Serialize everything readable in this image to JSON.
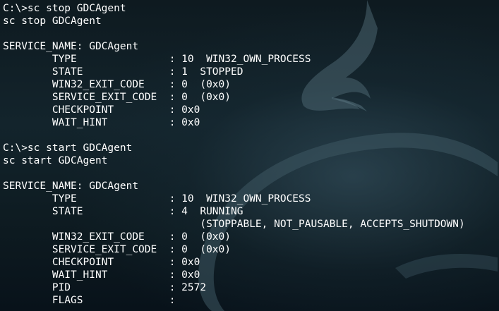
{
  "terminal": {
    "lines": [
      "C:\\>sc stop GDCAgent",
      "sc stop GDCAgent",
      "",
      "SERVICE_NAME: GDCAgent",
      "        TYPE               : 10  WIN32_OWN_PROCESS",
      "        STATE              : 1  STOPPED",
      "        WIN32_EXIT_CODE    : 0  (0x0)",
      "        SERVICE_EXIT_CODE  : 0  (0x0)",
      "        CHECKPOINT         : 0x0",
      "        WAIT_HINT          : 0x0",
      "",
      "C:\\>sc start GDCAgent",
      "sc start GDCAgent",
      "",
      "SERVICE_NAME: GDCAgent",
      "        TYPE               : 10  WIN32_OWN_PROCESS",
      "        STATE              : 4  RUNNING",
      "                                (STOPPABLE, NOT_PAUSABLE, ACCEPTS_SHUTDOWN)",
      "        WIN32_EXIT_CODE    : 0  (0x0)",
      "        SERVICE_EXIT_CODE  : 0  (0x0)",
      "        CHECKPOINT         : 0x0",
      "        WAIT_HINT          : 0x0",
      "        PID                : 2572",
      "        FLAGS              :"
    ]
  },
  "colors": {
    "text": "#ffffff",
    "background": "#0b1419",
    "watermark": "#4a6470"
  },
  "background_image": "kali-dragon-watermark"
}
